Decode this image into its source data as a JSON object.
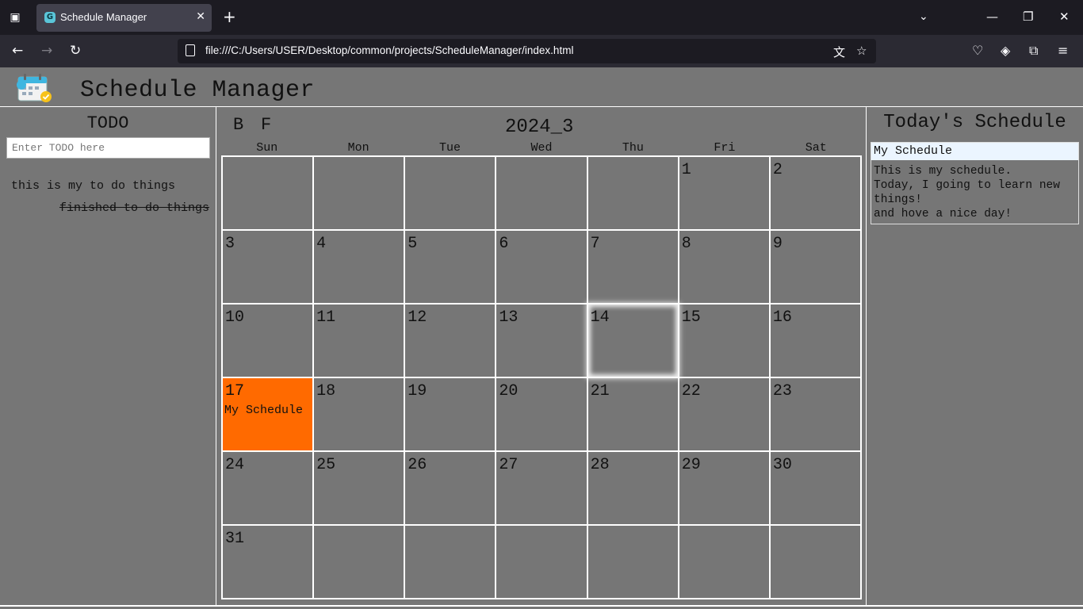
{
  "browser": {
    "tab_title": "Schedule Manager",
    "url": "file:///C:/Users/USER/Desktop/common/projects/ScheduleManager/index.html",
    "icons": {
      "tab_list": "tab-list-icon",
      "favicon": "app-favicon",
      "tab_close": "close-icon",
      "new_tab": "plus-icon",
      "overflow": "chevron-down-icon",
      "minimize": "minimize-icon",
      "restore": "restore-icon",
      "close_window": "close-icon",
      "back": "back-arrow-icon",
      "forward": "forward-arrow-icon",
      "reload": "reload-icon",
      "translate": "translate-icon",
      "bookmark": "star-icon",
      "pocket": "pocket-icon",
      "profile": "profile-icon",
      "extensions": "extensions-icon",
      "menu": "hamburger-menu-icon"
    }
  },
  "header": {
    "title": "Schedule Manager"
  },
  "todo": {
    "heading": "TODO",
    "placeholder": "Enter TODO here",
    "items": [
      "this is my to do things"
    ],
    "finished": [
      "finished to do things"
    ]
  },
  "calendar": {
    "back_label": "B",
    "forward_label": "F",
    "month_label": "2024_3",
    "weekdays": [
      "Sun",
      "Mon",
      "Tue",
      "Wed",
      "Thu",
      "Fri",
      "Sat"
    ],
    "cells": [
      "",
      "",
      "",
      "",
      "",
      "1",
      "2",
      "3",
      "4",
      "5",
      "6",
      "7",
      "8",
      "9",
      "10",
      "11",
      "12",
      "13",
      "14",
      "15",
      "16",
      "17",
      "18",
      "19",
      "20",
      "21",
      "22",
      "23",
      "24",
      "25",
      "26",
      "27",
      "28",
      "29",
      "30",
      "31",
      "",
      "",
      "",
      "",
      "",
      ""
    ],
    "today": "14",
    "selected": "17",
    "events": {
      "17": "My Schedule"
    },
    "colors": {
      "selected": "#ff6a00",
      "background": "#767676"
    }
  },
  "today_schedule": {
    "heading": "Today's Schedule",
    "title": "My Schedule",
    "body": "This is my schedule.\nToday, I going to learn new things!\nand hove a nice day!"
  }
}
